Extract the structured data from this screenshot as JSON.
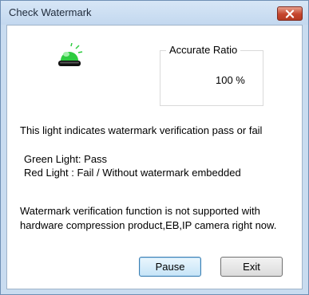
{
  "window": {
    "title": "Check Watermark"
  },
  "ratio": {
    "label": "Accurate Ratio",
    "value": "100 %"
  },
  "info": {
    "description": "This light indicates watermark verification pass or fail",
    "green": "Green Light:  Pass",
    "red": "Red Light  :  Fail / Without watermark embedded"
  },
  "note": {
    "text": "Watermark verification function is not supported with hardware compression product,EB,IP camera right now."
  },
  "buttons": {
    "pause": "Pause",
    "exit": "Exit"
  },
  "status": {
    "light_color": "#2ecc40",
    "light_state": "green"
  },
  "icons": {
    "close": "close-icon",
    "light": "green-light-icon"
  }
}
